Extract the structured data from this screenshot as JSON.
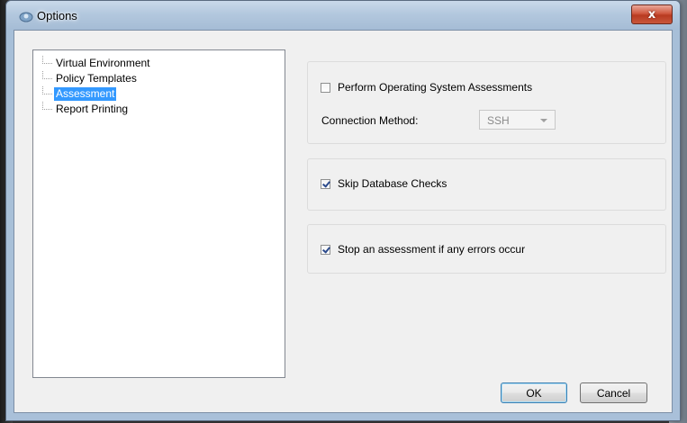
{
  "window": {
    "title": "Options",
    "close_glyph": "x"
  },
  "tree": {
    "items": [
      {
        "label": "Virtual Environment",
        "selected": false
      },
      {
        "label": "Policy Templates",
        "selected": false
      },
      {
        "label": "Assessment",
        "selected": true
      },
      {
        "label": "Report Printing",
        "selected": false
      }
    ]
  },
  "os_assessment": {
    "label": "Perform Operating System Assessments",
    "checked": false,
    "connection_label": "Connection Method:",
    "connection_value": "SSH"
  },
  "skip_db": {
    "label": "Skip Database Checks",
    "checked": true
  },
  "stop_on_error": {
    "label": "Stop an assessment if any errors occur",
    "checked": true
  },
  "buttons": {
    "ok": "OK",
    "cancel": "Cancel"
  },
  "colors": {
    "selection": "#3399ff",
    "close_button": "#c9573c"
  }
}
